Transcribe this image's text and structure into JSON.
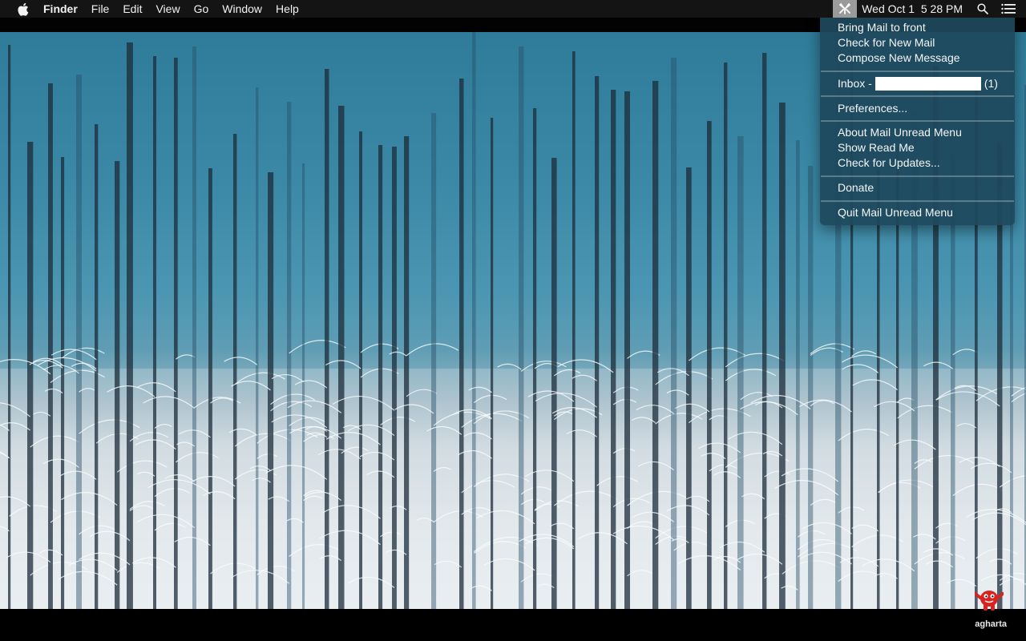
{
  "menubar": {
    "apple_icon": "apple-icon",
    "app_name": "Finder",
    "items": [
      "File",
      "Edit",
      "View",
      "Go",
      "Window",
      "Help"
    ],
    "status_icon": "mail-unread-icon",
    "clock": "Wed Oct 1  5 28 PM",
    "spotlight_icon": "search-icon",
    "notification_icon": "notification-center-icon"
  },
  "dropdown": {
    "group1": [
      "Bring Mail to front",
      "Check for New Mail",
      "Compose New Message"
    ],
    "inbox_label": "Inbox -",
    "inbox_count": "(1)",
    "preferences": "Preferences...",
    "group3": [
      "About Mail Unread Menu",
      "Show Read Me",
      "Check for Updates..."
    ],
    "donate": "Donate",
    "quit": "Quit Mail Unread Menu"
  },
  "desktop": {
    "user_label": "agharta",
    "mascot_icon": "red-mascot-icon"
  }
}
